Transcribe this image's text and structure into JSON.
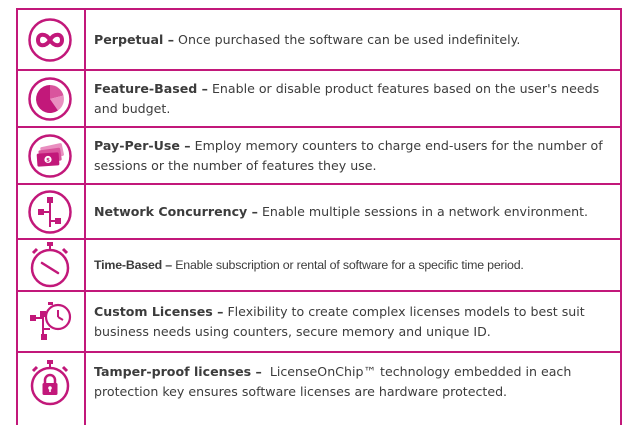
{
  "colors": {
    "accent": "#c2187a",
    "text": "#3c3c3c",
    "white": "#ffffff"
  },
  "rows": [
    {
      "icon": "infinity-icon",
      "title": "Perpetual –",
      "desc": "Once purchased the software can be used indefinitely."
    },
    {
      "icon": "pie-chart-icon",
      "title": "Feature-Based –",
      "desc": "Enable or disable product features based on the user's needs and budget."
    },
    {
      "icon": "money-stack-icon",
      "title": "Pay-Per-Use –",
      "desc": "Employ memory counters to charge end-users for the number of sessions or the number of features they use."
    },
    {
      "icon": "network-icon",
      "title": "Network Concurrency –",
      "desc": "Enable multiple sessions in a network environment."
    },
    {
      "icon": "clock-icon",
      "title": "Time-Based –",
      "desc": "Enable subscription or rental of software for a specific time period."
    },
    {
      "icon": "custom-license-icon",
      "title": "Custom Licenses –",
      "desc": "Flexibility to create complex licenses models to best suit business needs using counters, secure memory and unique ID."
    },
    {
      "icon": "lock-timer-icon",
      "title": "Tamper-proof licenses –",
      "desc": "LicenseOnChip™ technology embedded in each protection key ensures software licenses are hardware protected."
    }
  ]
}
